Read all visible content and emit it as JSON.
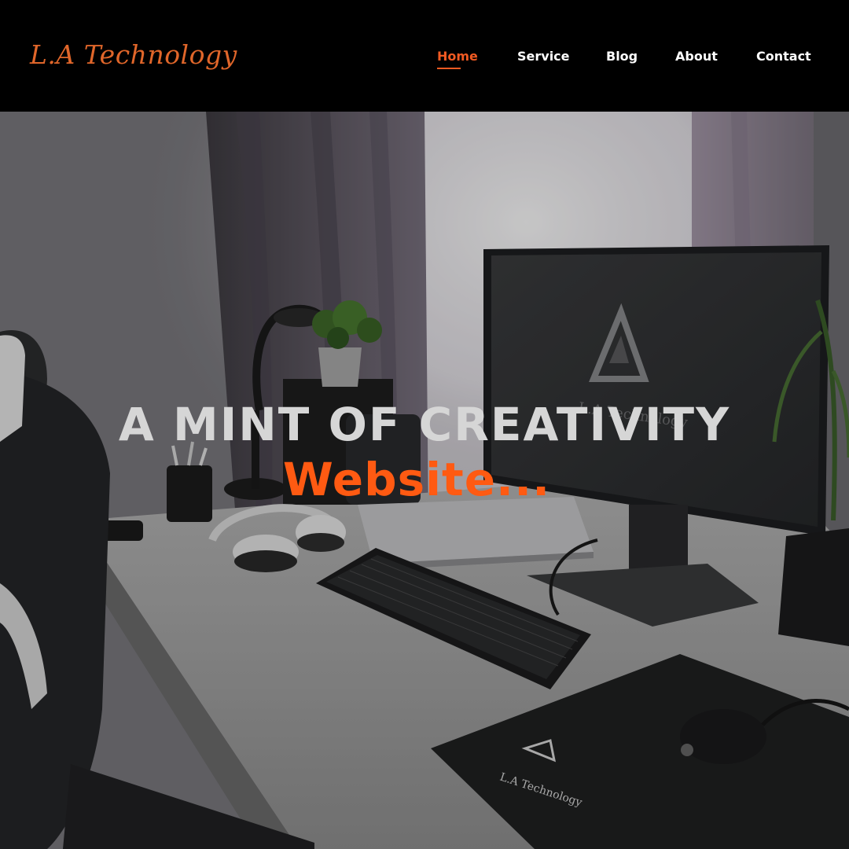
{
  "header": {
    "logo_text": "L.A Technology",
    "nav": [
      {
        "label": "Home",
        "active": true
      },
      {
        "label": "Service",
        "active": false
      },
      {
        "label": "Blog",
        "active": false
      },
      {
        "label": "About",
        "active": false
      },
      {
        "label": "Contact",
        "active": false
      }
    ]
  },
  "hero": {
    "title": "A MINT OF CREATIVITY",
    "subtitle": "Website...",
    "monitor_brand_text": "L.A Technology",
    "mousepad_brand_text": "L.A Technology"
  },
  "colors": {
    "accent": "#f05a22",
    "logo": "#e0662a",
    "header_bg": "#000000",
    "title_text": "#d6d6d6"
  }
}
